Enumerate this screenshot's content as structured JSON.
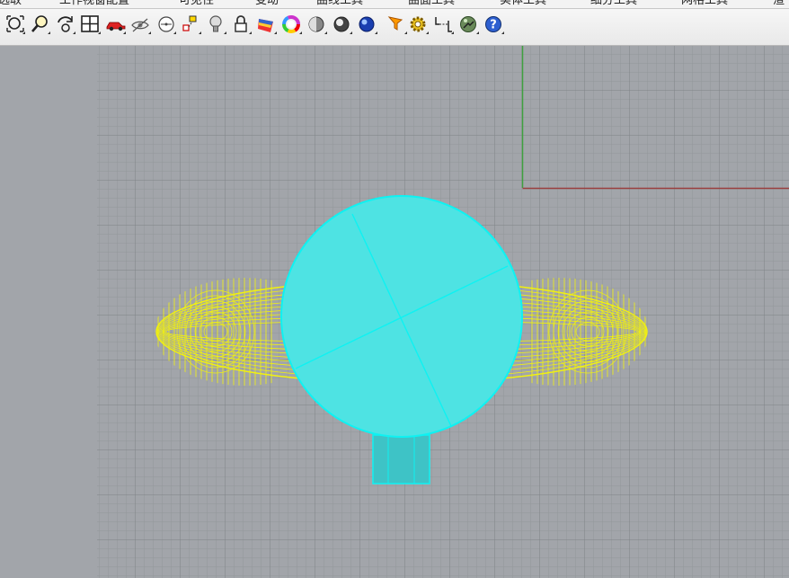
{
  "menu_tabs": [
    "选取",
    "工作视窗配置",
    "可见性",
    "变动",
    "曲线工具",
    "曲面工具",
    "实体工具",
    "细分工具",
    "网格工具",
    "渲"
  ],
  "toolbar": {
    "icons": [
      "zoom-extents-icon",
      "zoom-window-icon",
      "rotate-view-icon",
      "four-viewports-icon",
      "car-icon",
      "hide-object-icon",
      "cplane-icon",
      "object-snap-icon",
      "light-bulb-icon",
      "lock-icon",
      "color-palette-icon",
      "color-wheel-icon",
      "sphere-gray-icon",
      "sphere-shaded-icon",
      "sphere-blue-icon",
      "select-filter-icon",
      "settings-gear-icon",
      "dimension-icon",
      "render-icon",
      "help-icon"
    ]
  },
  "colors": {
    "background": "#a2a5aa",
    "grid_minor": "#939699",
    "grid_major": "#7d8085",
    "axis_x": "#9a3f3f",
    "axis_y": "#3fa13f",
    "wire_yellow": "#f2f20d",
    "sphere_fill": "#4ee3e3",
    "sphere_edge": "#0ef2f2"
  },
  "viewport": {
    "grid": true,
    "objects": [
      "sphere",
      "torus",
      "cylinder"
    ]
  }
}
